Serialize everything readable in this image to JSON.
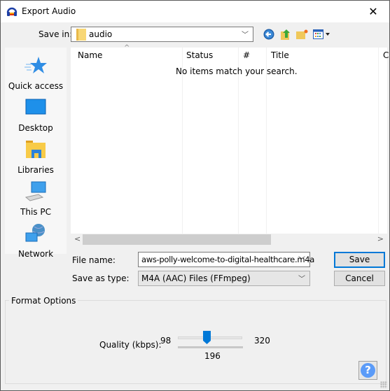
{
  "window": {
    "title": "Export Audio",
    "close_icon": "close-icon"
  },
  "toolbar": {
    "save_in_label": "Save in:",
    "save_in_value": "audio",
    "icons": [
      "back-icon",
      "up-folder-icon",
      "new-folder-icon",
      "view-menu-icon"
    ]
  },
  "places": [
    {
      "label": "Quick access",
      "icon": "quick-access-star-icon"
    },
    {
      "label": "Desktop",
      "icon": "desktop-icon"
    },
    {
      "label": "Libraries",
      "icon": "libraries-icon"
    },
    {
      "label": "This PC",
      "icon": "this-pc-icon"
    },
    {
      "label": "Network",
      "icon": "network-icon"
    }
  ],
  "file_list": {
    "columns": [
      "Name",
      "Status",
      "#",
      "Title",
      "C"
    ],
    "sorted_column": "Name",
    "empty_message": "No items match your search."
  },
  "form": {
    "file_name_label": "File name:",
    "file_name_value": "aws-polly-welcome-to-digital-healthcare.m4a",
    "save_as_type_label": "Save as type:",
    "save_as_type_value": "M4A (AAC) Files (FFmpeg)",
    "save_button": "Save",
    "cancel_button": "Cancel"
  },
  "format_options": {
    "group_label": "Format Options",
    "quality_label": "Quality (kbps):",
    "min": "98",
    "max": "320",
    "value": "196",
    "min_num": 98,
    "max_num": 320,
    "value_num": 196,
    "help_label": "?"
  },
  "colors": {
    "accent": "#0078d7",
    "help": "#5b9bf8"
  }
}
